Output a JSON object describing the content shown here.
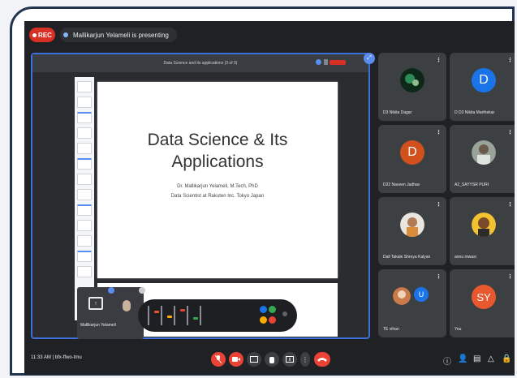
{
  "recording": {
    "badge": "REC",
    "status": "Mallikarjun Yelameli is presenting"
  },
  "presentation": {
    "doc_title": "Data Science and its applications (3 of 9)",
    "slide": {
      "title_line1": "Data Science & Its",
      "title_line2": "Applications",
      "author": "Dr. Mallikarjun Yelameli, M.Tech, PhD",
      "role": "Data Scientist at Rakuten Inc. Tokyo Japan"
    },
    "presenter_label": "Mallikarjun Yelameli"
  },
  "participants": [
    {
      "name": "D3 Nikita Dagar",
      "kind": "photo"
    },
    {
      "name": "D D3 Nikita Marthekar",
      "initial": "D",
      "color": "#1a73e8",
      "kind": "letter"
    },
    {
      "name": "D22 Naveen Jadhav",
      "initial": "D",
      "color": "#d2501b",
      "kind": "letter"
    },
    {
      "name": "A2_SAYYSR PURI",
      "kind": "photo"
    },
    {
      "name": "Dall Takale Shreya Kalyan",
      "kind": "photo"
    },
    {
      "name": "annu mwasi",
      "kind": "photo"
    },
    {
      "name": "TE vihan",
      "kind": "photo"
    },
    {
      "name": "You",
      "initial": "SY",
      "color": "#e8572e",
      "kind": "letter"
    }
  ],
  "footer": {
    "time_and_code": "11:33 AM | bfx-ffwo-tmu"
  },
  "colors": {
    "meet_bg": "#1f2124",
    "tile_bg": "#3c4043",
    "accent_blue": "#1a73e8",
    "danger_red": "#ea4335"
  }
}
